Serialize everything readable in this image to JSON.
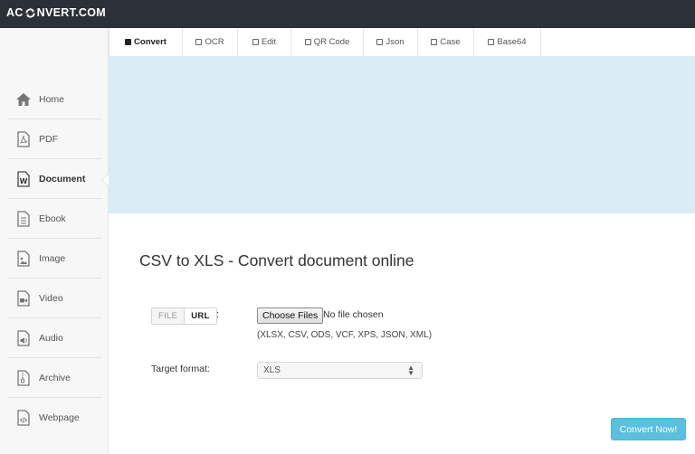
{
  "header": {
    "logo_left": "AC",
    "logo_right": "NVERT.COM"
  },
  "tabs": [
    {
      "label": "Convert",
      "active": true
    },
    {
      "label": "OCR",
      "active": false
    },
    {
      "label": "Edit",
      "active": false
    },
    {
      "label": "QR Code",
      "active": false
    },
    {
      "label": "Json",
      "active": false
    },
    {
      "label": "Case",
      "active": false
    },
    {
      "label": "Base64",
      "active": false
    }
  ],
  "sidebar": {
    "items": [
      {
        "label": "Home",
        "icon": "home-icon"
      },
      {
        "label": "PDF",
        "icon": "pdf-icon"
      },
      {
        "label": "Document",
        "icon": "word-document-icon",
        "active": true
      },
      {
        "label": "Ebook",
        "icon": "ebook-icon"
      },
      {
        "label": "Image",
        "icon": "image-icon"
      },
      {
        "label": "Video",
        "icon": "video-icon"
      },
      {
        "label": "Audio",
        "icon": "audio-icon"
      },
      {
        "label": "Archive",
        "icon": "archive-icon"
      },
      {
        "label": "Webpage",
        "icon": "webpage-icon"
      }
    ]
  },
  "main": {
    "title": "CSV to XLS - Convert document online",
    "source_toggle": {
      "file": "FILE",
      "url": "URL",
      "colon": ":"
    },
    "choose_files_label": "Choose Files",
    "no_file_text": "No file chosen",
    "accepted_formats": "(XLSX, CSV, ODS, VCF, XPS, JSON, XML)",
    "target_format_label": "Target format:",
    "target_format_value": "XLS",
    "convert_button": "Convert Now!"
  },
  "colors": {
    "topbar": "#2b3137",
    "banner": "#d9ecf4",
    "convert_button": "#5bc0de"
  }
}
